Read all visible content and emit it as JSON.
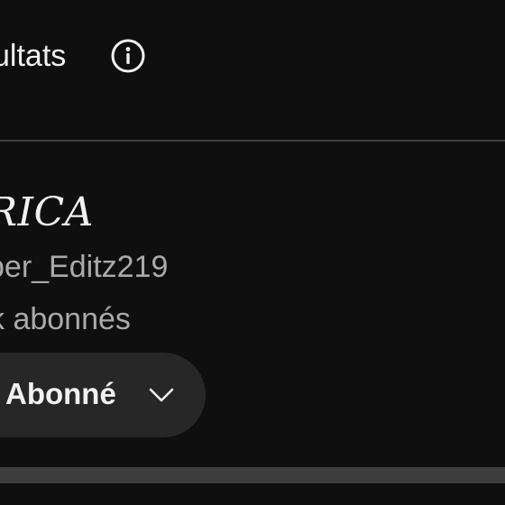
{
  "header": {
    "results_label": "ultats",
    "info_icon": "info-circle-icon"
  },
  "channel": {
    "name": "RICA",
    "handle": "per_Editz219",
    "subscribers": "k abonnés"
  },
  "subscribe_button": {
    "label": "Abonné",
    "icon": "chevron-down-icon"
  },
  "colors": {
    "background": "#0f0f0f",
    "primary_text": "#f1f1f1",
    "secondary_text": "#aaaaaa",
    "button_background": "#272727",
    "divider": "#3f3f3f"
  }
}
